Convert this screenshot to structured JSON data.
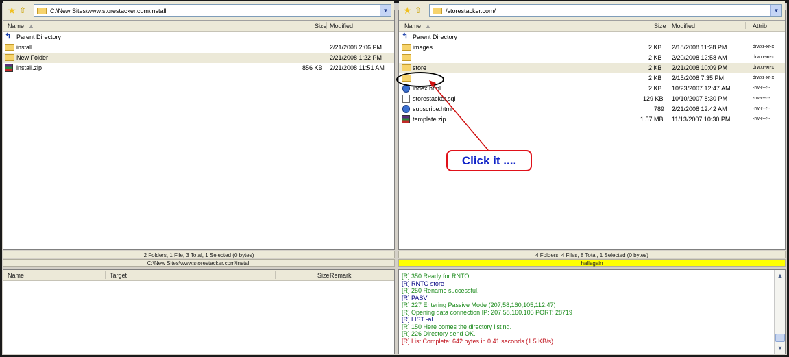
{
  "left_pane": {
    "path": "C:\\New Sites\\www.storestacker.com\\install",
    "columns": {
      "name": "Name",
      "size": "Size",
      "modified": "Modified"
    },
    "rows": [
      {
        "name": "Parent Directory",
        "size": "",
        "modified": "",
        "icon": "parent-icon"
      },
      {
        "name": "install",
        "size": "",
        "modified": "2/21/2008 2:06 PM",
        "icon": "folder-icon"
      },
      {
        "name": "New Folder",
        "size": "",
        "modified": "2/21/2008 1:22 PM",
        "icon": "folder-icon"
      },
      {
        "name": "install.zip",
        "size": "856 KB",
        "modified": "2/21/2008 11:51 AM",
        "icon": "zip-icon"
      }
    ],
    "status": "2 Folders, 1 File, 3 Total, 1 Selected (0 bytes)",
    "status_path": "C:\\New Sites\\www.storestacker.com\\install"
  },
  "right_pane": {
    "path": "/storestacker.com/",
    "columns": {
      "name": "Name",
      "size": "Size",
      "modified": "Modified",
      "attrib": "Attrib"
    },
    "rows": [
      {
        "name": "Parent Directory",
        "size": "",
        "modified": "",
        "attrib": "",
        "icon": "parent-icon"
      },
      {
        "name": "images",
        "size": "2 KB",
        "modified": "2/18/2008 11:28 PM",
        "attrib": "drwxr-xr-x",
        "icon": "folder-icon"
      },
      {
        "name": "",
        "size": "2 KB",
        "modified": "2/20/2008 12:58 AM",
        "attrib": "drwxr-xr-x",
        "icon": "folder-icon"
      },
      {
        "name": "store",
        "size": "2 KB",
        "modified": "2/21/2008 10:09 PM",
        "attrib": "drwxr-xr-x",
        "icon": "folder-icon"
      },
      {
        "name": "",
        "size": "2 KB",
        "modified": "2/15/2008 7:35 PM",
        "attrib": "drwxr-xr-x",
        "icon": "folder-icon"
      },
      {
        "name": "index.html",
        "size": "2 KB",
        "modified": "10/23/2007 12:47 AM",
        "attrib": "-rw-r--r--",
        "icon": "html-icon"
      },
      {
        "name": "storestacker.sql",
        "size": "129 KB",
        "modified": "10/10/2007 8:30 PM",
        "attrib": "-rw-r--r--",
        "icon": "file-icon"
      },
      {
        "name": "subscribe.html",
        "size": "789",
        "modified": "2/21/2008 12:42 AM",
        "attrib": "-rw-r--r--",
        "icon": "html-icon"
      },
      {
        "name": "template.zip",
        "size": "1.57 MB",
        "modified": "11/13/2007 10:30 PM",
        "attrib": "-rw-r--r--",
        "icon": "zip-icon"
      }
    ],
    "status": "4 Folders, 4 Files, 8 Total, 1 Selected (0 bytes)",
    "status_user": "hallagain"
  },
  "queue_pane": {
    "columns": {
      "name": "Name",
      "target": "Target",
      "size": "Size",
      "remark": "Remark"
    }
  },
  "log": [
    {
      "text": "[R] 350 Ready for RNTO.",
      "color": "#1a8a1a"
    },
    {
      "text": "[R] RNTO store",
      "color": "#000080"
    },
    {
      "text": "[R] 250 Rename successful.",
      "color": "#1a8a1a"
    },
    {
      "text": "[R] PASV",
      "color": "#000080"
    },
    {
      "text": "[R] 227 Entering Passive Mode (207,58,160,105,112,47)",
      "color": "#1a8a1a"
    },
    {
      "text": "[R] Opening data connection IP: 207.58.160.105 PORT: 28719",
      "color": "#1a8a1a"
    },
    {
      "text": "[R] LIST -al",
      "color": "#000080"
    },
    {
      "text": "[R] 150 Here comes the directory listing.",
      "color": "#1a8a1a"
    },
    {
      "text": "[R] 226 Directory send OK.",
      "color": "#1a8a1a"
    },
    {
      "text": "[R] List Complete: 642 bytes in 0.41 seconds (1.5 KB/s)",
      "color": "#c0101a"
    }
  ],
  "callout": {
    "text": "Click it ...."
  },
  "colors": {
    "selected_row": "#ece9d8",
    "status_highlight": "#ffff00",
    "callout_border": "#e0121a",
    "callout_text": "#1024c8"
  }
}
